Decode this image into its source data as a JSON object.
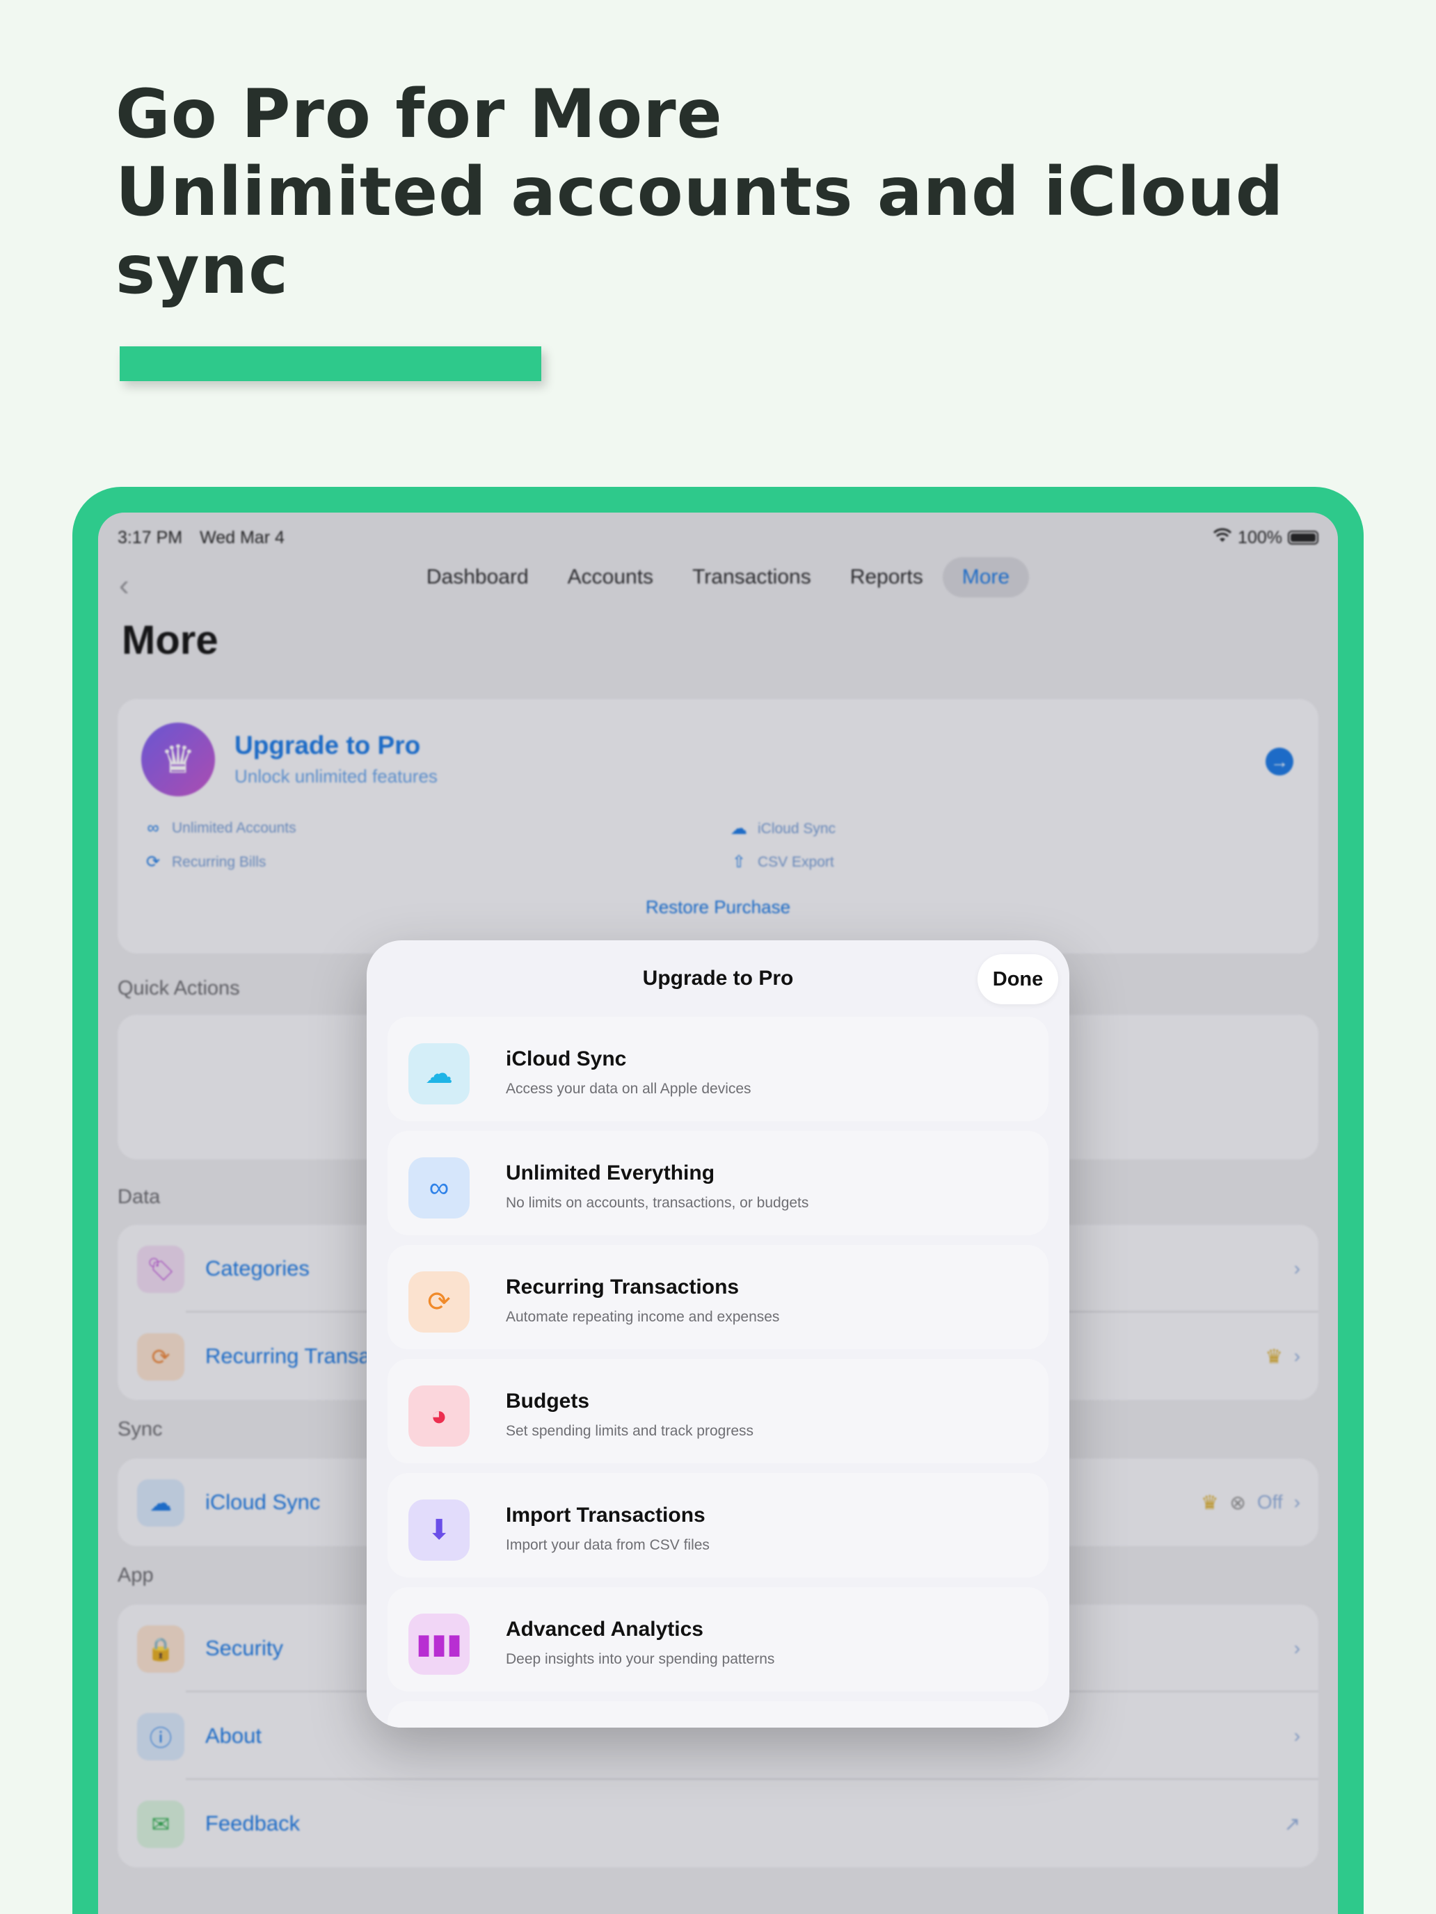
{
  "headline": {
    "line1": "Go Pro for More",
    "line2": "Unlimited accounts and iCloud",
    "line3": "sync"
  },
  "colors": {
    "accent": "#2ec98b",
    "blue": "#0a6ee0",
    "crown": "#d4a215"
  },
  "status_bar": {
    "time": "3:17 PM",
    "date": "Wed Mar 4",
    "battery": "100%"
  },
  "nav": {
    "back_icon": "chevron-left-icon",
    "tabs": [
      "Dashboard",
      "Accounts",
      "Transactions",
      "Reports",
      "More"
    ],
    "active_tab": "More"
  },
  "page_title": "More",
  "upgrade_card": {
    "title": "Upgrade to Pro",
    "subtitle": "Unlock unlimited features",
    "features": [
      "Unlimited Accounts",
      "iCloud Sync",
      "Recurring Bills",
      "CSV Export"
    ],
    "restore_label": "Restore Purchase"
  },
  "sections": {
    "quick_actions": "Quick Actions",
    "data": {
      "label": "Data",
      "items": [
        "Categories",
        "Recurring Transac"
      ]
    },
    "sync": {
      "label": "Sync",
      "item": "iCloud Sync",
      "status": "Off"
    },
    "app": {
      "label": "App",
      "items": [
        "Security",
        "About",
        "Feedback"
      ]
    }
  },
  "modal": {
    "title": "Upgrade to Pro",
    "done_label": "Done",
    "features": [
      {
        "title": "iCloud Sync",
        "subtitle": "Access your data on all Apple devices",
        "icon": "cloud-icon"
      },
      {
        "title": "Unlimited Everything",
        "subtitle": "No limits on accounts, transactions, or budgets",
        "icon": "infinity-icon"
      },
      {
        "title": "Recurring Transactions",
        "subtitle": "Automate repeating income and expenses",
        "icon": "repeat-icon"
      },
      {
        "title": "Budgets",
        "subtitle": "Set spending limits and track progress",
        "icon": "pie-chart-icon"
      },
      {
        "title": "Import Transactions",
        "subtitle": "Import your data from CSV files",
        "icon": "import-icon"
      },
      {
        "title": "Advanced Analytics",
        "subtitle": "Deep insights into your spending patterns",
        "icon": "bar-chart-icon"
      }
    ]
  }
}
